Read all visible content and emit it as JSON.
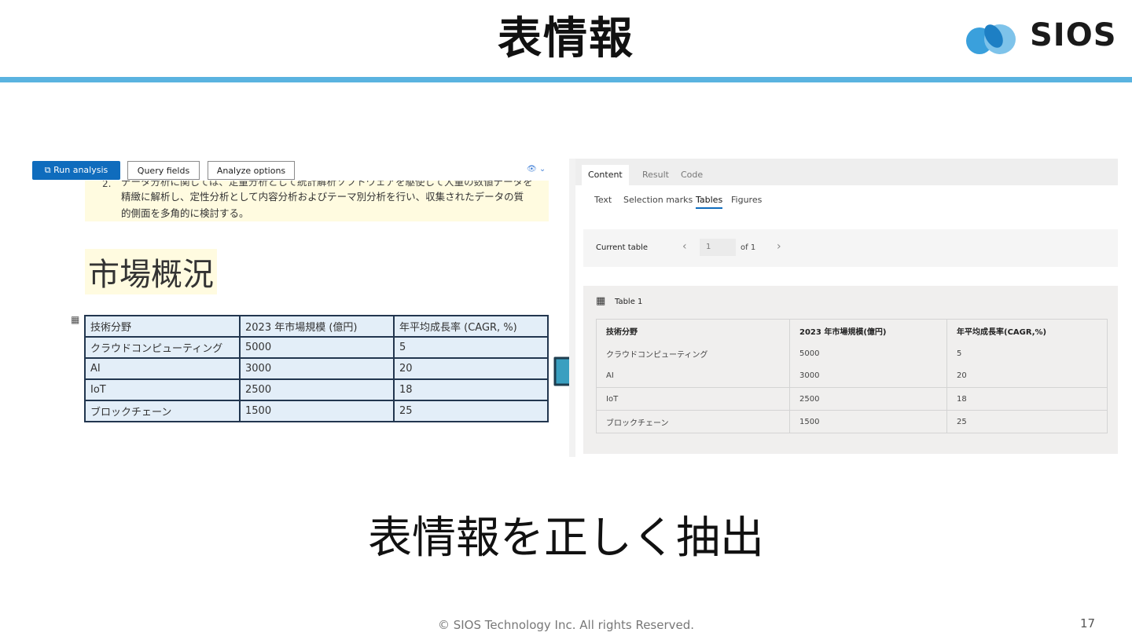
{
  "slide": {
    "title": "表情報",
    "caption": "表情報を正しく抽出",
    "copyright": "© SIOS Technology Inc. All rights Reserved.",
    "page_number": "17",
    "header_bar_color": "#5ab3e0",
    "logo": {
      "text": "SIOS",
      "icon": "sios-logo-icon"
    }
  },
  "left_screenshot": {
    "toolbar": {
      "run_button": "Run analysis",
      "query_button": "Query fields",
      "options_button": "Analyze options",
      "accent_color": "#0f6cbd"
    },
    "paragraph": {
      "number": "2.",
      "line_clipped": "データ分析に関しては、定量分析として統計解析ソフトウェアを駆使して大量の数値データを",
      "line_2": "精緻に解析し、定性分析として内容分析およびテーマ別分析を行い、収集されたデータの質",
      "line_3": "的側面を多角的に検討する。"
    },
    "heading": "市場概況",
    "table": {
      "headers": [
        "技術分野",
        "2023 年市場規模 (億円)",
        "年平均成長率 (CAGR, %)"
      ],
      "rows": [
        [
          "クラウドコンピューティング",
          "5000",
          "5"
        ],
        [
          "AI",
          "3000",
          "20"
        ],
        [
          "IoT",
          "2500",
          "18"
        ],
        [
          "ブロックチェーン",
          "1500",
          "25"
        ]
      ]
    }
  },
  "right_screenshot": {
    "tabs": [
      "Content",
      "Result",
      "Code"
    ],
    "active_tab": "Content",
    "subtabs": [
      "Text",
      "Selection marks",
      "Tables",
      "Figures"
    ],
    "active_subtab": "Tables",
    "current_table": {
      "label": "Current table",
      "value": "1",
      "of_label": "of 1"
    },
    "table_title": "Table 1",
    "table": {
      "headers": [
        "技術分野",
        "2023 年市場規模(億円)",
        "年平均成長率(CAGR,%)"
      ],
      "rows": [
        [
          "クラウドコンピューティング",
          "5000",
          "5"
        ],
        [
          "AI",
          "3000",
          "20"
        ],
        [
          "IoT",
          "2500",
          "18"
        ],
        [
          "ブロックチェーン",
          "1500",
          "25"
        ]
      ]
    }
  }
}
